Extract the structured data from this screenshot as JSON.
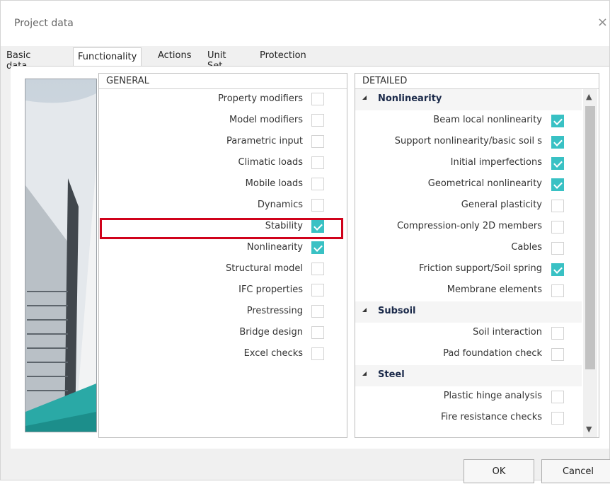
{
  "window": {
    "title": "Project data",
    "close_glyph": "×"
  },
  "tabs": [
    "Basic data",
    "Functionality",
    "Actions",
    "Unit Set",
    "Protection"
  ],
  "general": {
    "header": "GENERAL",
    "items": [
      {
        "label": "Property modifiers",
        "checked": false
      },
      {
        "label": "Model modifiers",
        "checked": false
      },
      {
        "label": "Parametric input",
        "checked": false
      },
      {
        "label": "Climatic loads",
        "checked": false
      },
      {
        "label": "Mobile loads",
        "checked": false
      },
      {
        "label": "Dynamics",
        "checked": false
      },
      {
        "label": "Stability",
        "checked": true
      },
      {
        "label": "Nonlinearity",
        "checked": true
      },
      {
        "label": "Structural model",
        "checked": false
      },
      {
        "label": "IFC properties",
        "checked": false
      },
      {
        "label": "Prestressing",
        "checked": false
      },
      {
        "label": "Bridge design",
        "checked": false
      },
      {
        "label": "Excel checks",
        "checked": false
      }
    ]
  },
  "detailed": {
    "header": "DETAILED",
    "rows": [
      {
        "group": "Nonlinearity"
      },
      {
        "label": "Beam local nonlinearity",
        "checked": true
      },
      {
        "label": "Support nonlinearity/basic soil s",
        "checked": true
      },
      {
        "label": "Initial imperfections",
        "checked": true
      },
      {
        "label": "Geometrical nonlinearity",
        "checked": true
      },
      {
        "label": "General plasticity",
        "checked": false
      },
      {
        "label": "Compression-only 2D members",
        "checked": false
      },
      {
        "label": "Cables",
        "checked": false
      },
      {
        "label": "Friction support/Soil spring",
        "checked": true
      },
      {
        "label": "Membrane elements",
        "checked": false
      },
      {
        "group": "Subsoil"
      },
      {
        "label": "Soil interaction",
        "checked": false
      },
      {
        "label": "Pad foundation check",
        "checked": false
      },
      {
        "group": "Steel"
      },
      {
        "label": "Plastic hinge analysis",
        "checked": false
      },
      {
        "label": "Fire resistance checks",
        "checked": false
      }
    ]
  },
  "buttons": {
    "ok": "OK",
    "cancel": "Cancel"
  },
  "colors": {
    "checkbox_checked": "#39c1c4",
    "highlight": "#d0021b"
  }
}
